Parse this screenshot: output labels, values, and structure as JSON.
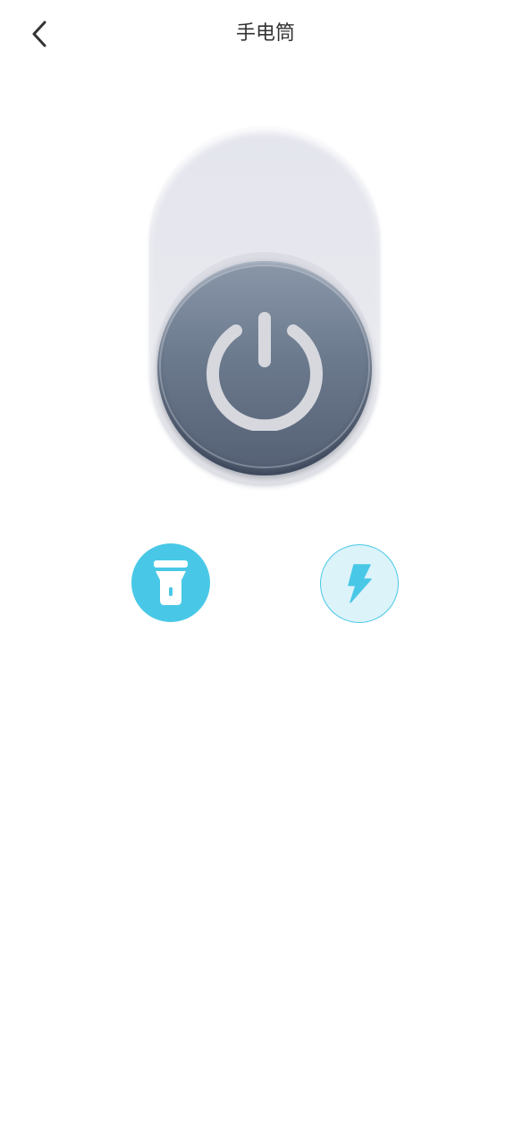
{
  "header": {
    "title": "手电筒",
    "back_icon": "chevron-left-icon"
  },
  "power_switch": {
    "icon": "power-icon",
    "state": "off"
  },
  "modes": [
    {
      "icon": "flashlight-icon",
      "selected": true
    },
    {
      "icon": "lightning-icon",
      "selected": false
    }
  ],
  "colors": {
    "accent": "#48c8e6",
    "accent_light": "#dcf3fa",
    "knob": "#6c7a8e",
    "track": "#e6e7ee",
    "title_text": "#333333"
  }
}
